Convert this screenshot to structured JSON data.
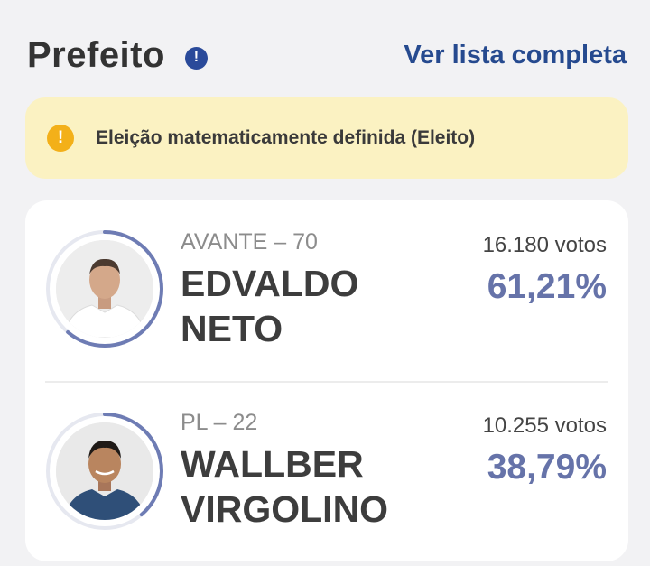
{
  "header": {
    "title": "Prefeito",
    "info_icon": "info-icon",
    "link_label": "Ver lista completa",
    "link_color": "#264a8f"
  },
  "alert": {
    "icon": "info-icon",
    "text": "Eleição matematicamente definida (Eleito)",
    "background": "#fbf2c2",
    "icon_color": "#f3b019"
  },
  "candidates": [
    {
      "party": "AVANTE – 70",
      "name_line1": "EDVALDO",
      "name_line2": "NETO",
      "votes": "16.180 votos",
      "percent": "61,21%",
      "share": 0.6121
    },
    {
      "party": "PL – 22",
      "name_line1": "WALLBER",
      "name_line2": "VIRGOLINO",
      "votes": "10.255 votos",
      "percent": "38,79%",
      "share": 0.3879
    }
  ],
  "colors": {
    "percent": "#6673a9",
    "ring": "#6e7cb4",
    "ring_track": "#e6e8f0"
  }
}
